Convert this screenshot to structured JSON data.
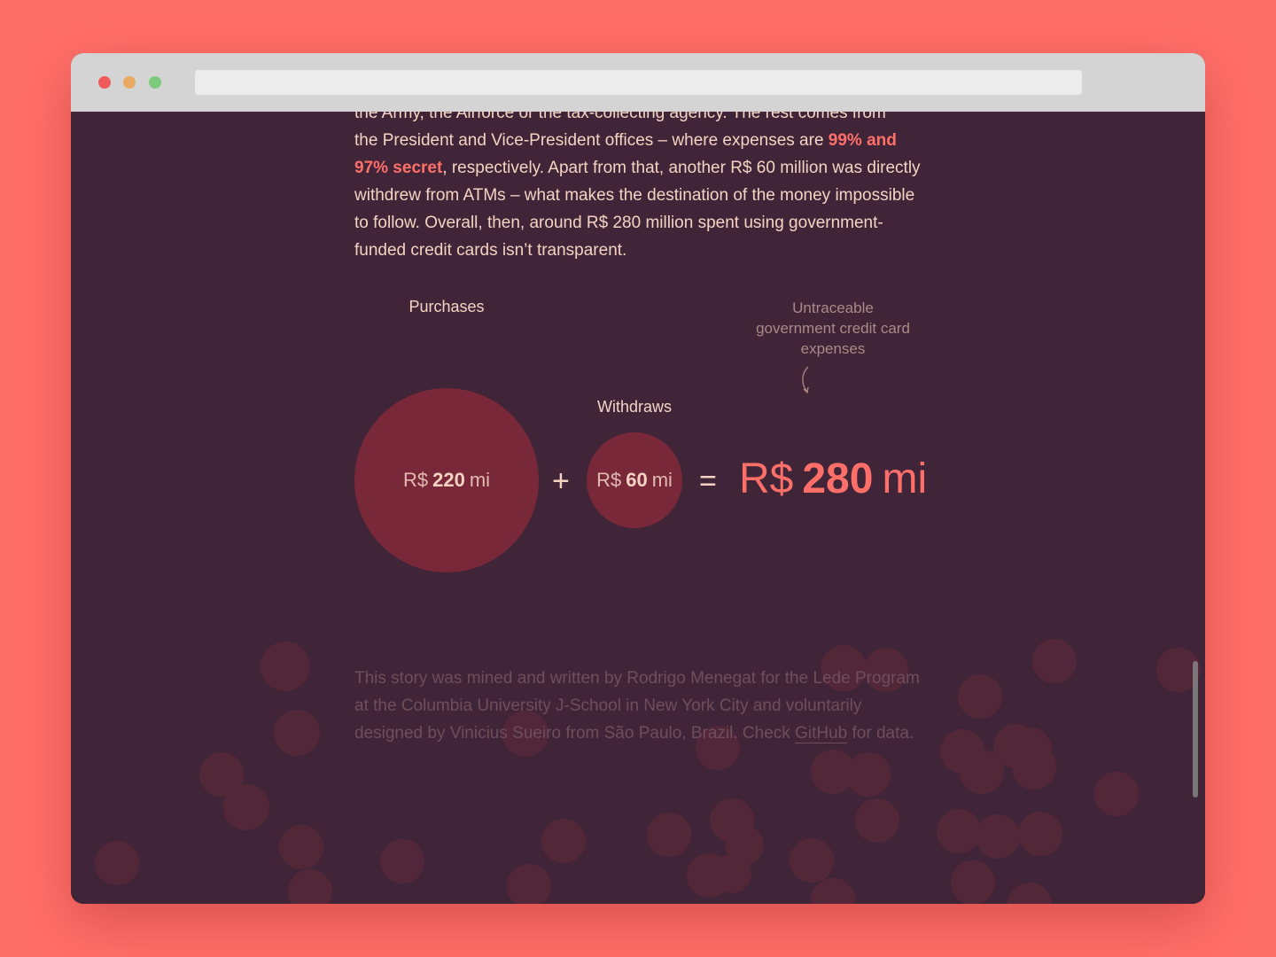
{
  "window": {
    "traffic_lights": [
      "#f05a5a",
      "#e9ab64",
      "#7ccb7c"
    ],
    "address_bar": ""
  },
  "article": {
    "line_cut": "the Army, the Airforce or the tax-collecting agency. The rest comes from",
    "text_1": "the President and Vice-President offices – where expenses are ",
    "highlight": "99% and 97% secret",
    "text_2": ", respectively. Apart from that, another R$ 60 million was directly withdrew from ATMs – what makes the destination of the money impossible to follow. Overall, then, around R$ 280 million spent using government-funded credit cards isn’t transparent."
  },
  "equation": {
    "purchases": {
      "label": "Purchases",
      "currency": "R$",
      "value": "220",
      "unit": "mi"
    },
    "plus": "+",
    "withdraws": {
      "label": "Withdraws",
      "currency": "R$",
      "value": "60",
      "unit": "mi"
    },
    "equals": "=",
    "total": {
      "note": "Untraceable government credit card expenses",
      "currency": "R$",
      "value": "280",
      "unit": "mi"
    }
  },
  "credits": {
    "text": "This story was mined and written by Rodrigo Menegat for the Lede Program at the Columbia University J-School in New York City and voluntarily designed by Vinicius Sueiro from São Paulo, Brazil. Check ",
    "link": "GitHub",
    "text_end": " for data."
  },
  "colors": {
    "page_background": "#ff6f6a",
    "content_background": "#3f2537",
    "accent": "#ff6f6a",
    "bubble": "#79283a",
    "text": "#f4d3c3"
  }
}
